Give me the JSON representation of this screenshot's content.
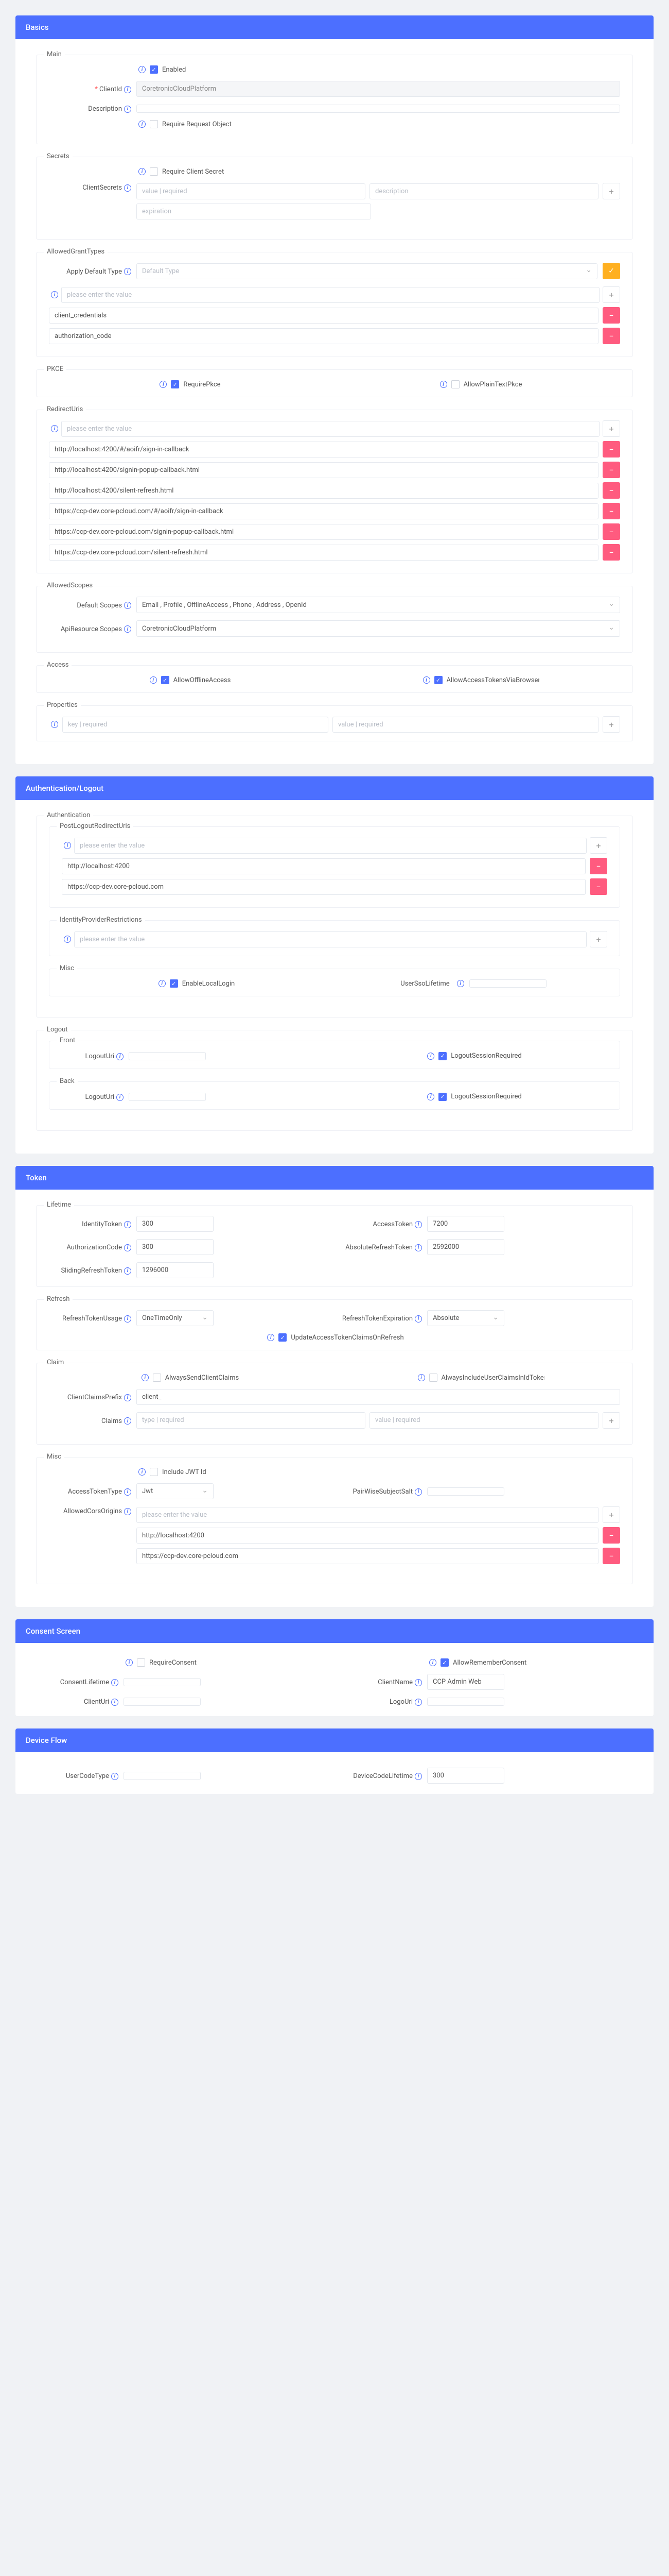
{
  "basics": {
    "header": "Basics",
    "main": {
      "title": "Main",
      "enabled_label": "Enabled",
      "clientid_label": "ClientId",
      "clientid_value": "CoretronicCloudPlatform",
      "description_label": "Description",
      "require_request_object_label": "Require Request Object"
    },
    "secrets": {
      "title": "Secrets",
      "require_client_secret_label": "Require Client Secret",
      "client_secrets_label": "ClientSecrets",
      "value_ph": "value | required",
      "desc_ph": "description",
      "expiration_ph": "expiration"
    },
    "grant": {
      "title": "AllowedGrantTypes",
      "apply_default_label": "Apply Default Type",
      "default_type_ph": "Default Type",
      "enter_value_ph": "please enter the value",
      "items": [
        "client_credentials",
        "authorization_code"
      ]
    },
    "pkce": {
      "title": "PKCE",
      "require_pkce_label": "RequirePkce",
      "allow_plain_text_label": "AllowPlainTextPkce"
    },
    "redirect": {
      "title": "RedirectUris",
      "enter_value_ph": "please enter the value",
      "items": [
        "http://localhost:4200/#/aoifr/sign-in-callback",
        "http://localhost:4200/signin-popup-callback.html",
        "http://localhost:4200/silent-refresh.html",
        "https://ccp-dev.core-pcloud.com/#/aoifr/sign-in-callback",
        "https://ccp-dev.core-pcloud.com/signin-popup-callback.html",
        "https://ccp-dev.core-pcloud.com/silent-refresh.html"
      ]
    },
    "scopes": {
      "title": "AllowedScopes",
      "default_scopes_label": "Default Scopes",
      "default_scopes_value": "Email , Profile , OfflineAccess , Phone , Address , OpenId",
      "api_resource_scopes_label": "ApiResource Scopes",
      "api_resource_scopes_value": "CoretronicCloudPlatform"
    },
    "access": {
      "title": "Access",
      "allow_offline_label": "AllowOfflineAccess",
      "allow_access_tokens_label": "AllowAccessTokensViaBrowser"
    },
    "properties": {
      "title": "Properties",
      "key_ph": "key | required",
      "value_ph": "value | required"
    }
  },
  "auth": {
    "header": "Authentication/Logout",
    "authentication": {
      "title": "Authentication",
      "post_logout": {
        "title": "PostLogoutRedirectUris",
        "enter_value_ph": "please enter the value",
        "items": [
          "http://localhost:4200",
          "https://ccp-dev.core-pcloud.com"
        ]
      },
      "idp": {
        "title": "IdentityProviderRestrictions",
        "enter_value_ph": "please enter the value"
      },
      "misc": {
        "title": "Misc",
        "enable_local_login_label": "EnableLocalLogin",
        "user_sso_lifetime_label": "UserSsoLifetime"
      }
    },
    "logout": {
      "title": "Logout",
      "front": {
        "title": "Front",
        "logout_uri_label": "LogoutUri",
        "logout_session_required_label": "LogoutSessionRequired"
      },
      "back": {
        "title": "Back",
        "logout_uri_label": "LogoutUri",
        "logout_session_required_label": "LogoutSessionRequired"
      }
    }
  },
  "token": {
    "header": "Token",
    "lifetime": {
      "title": "Lifetime",
      "identity_token_label": "IdentityToken",
      "identity_token_value": "300",
      "access_token_label": "AccessToken",
      "access_token_value": "7200",
      "authorization_code_label": "AuthorizationCode",
      "authorization_code_value": "300",
      "absolute_refresh_token_label": "AbsoluteRefreshToken",
      "absolute_refresh_token_value": "2592000",
      "sliding_refresh_token_label": "SlidingRefreshToken",
      "sliding_refresh_token_value": "1296000"
    },
    "refresh": {
      "title": "Refresh",
      "usage_label": "RefreshTokenUsage",
      "usage_value": "OneTimeOnly",
      "expiration_label": "RefreshTokenExpiration",
      "expiration_value": "Absolute",
      "update_claims_label": "UpdateAccessTokenClaimsOnRefresh"
    },
    "claim": {
      "title": "Claim",
      "always_send_label": "AlwaysSendClientClaims",
      "always_include_label": "AlwaysIncludeUserClaimsInIdToken",
      "claims_prefix_label": "ClientClaimsPrefix",
      "claims_prefix_value": "client_",
      "claims_label": "Claims",
      "type_ph": "type | required",
      "value_ph": "value | required"
    },
    "misc": {
      "title": "Misc",
      "include_jwt_label": "Include JWT Id",
      "access_token_type_label": "AccessTokenType",
      "access_token_type_value": "Jwt",
      "pairwise_label": "PairWiseSubjectSalt",
      "allowed_cors_label": "AllowedCorsOrigins",
      "enter_value_ph": "please enter the value",
      "cors_items": [
        "http://localhost:4200",
        "https://ccp-dev.core-pcloud.com"
      ]
    }
  },
  "consent": {
    "header": "Consent Screen",
    "require_consent_label": "RequireConsent",
    "allow_remember_label": "AllowRememberConsent",
    "consent_lifetime_label": "ConsentLifetime",
    "client_name_label": "ClientName",
    "client_name_value": "CCP Admin Web",
    "client_uri_label": "ClientUri",
    "logo_uri_label": "LogoUri"
  },
  "device": {
    "header": "Device Flow",
    "user_code_type_label": "UserCodeType",
    "device_code_lifetime_label": "DeviceCodeLifetime",
    "device_code_lifetime_value": "300"
  }
}
